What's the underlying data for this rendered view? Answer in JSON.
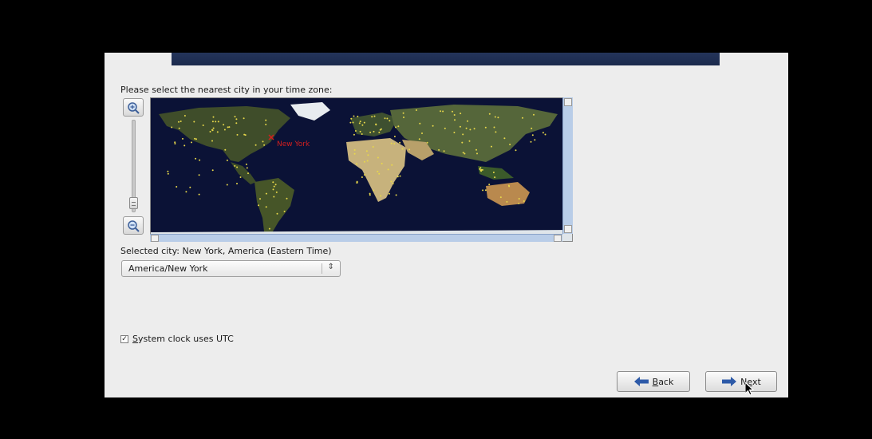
{
  "prompt_label": "Please select the nearest city in your time zone:",
  "map": {
    "highlighted_city": "New York",
    "marker_color": "#d21f1f",
    "city_dot_color": "#e8d84a",
    "ocean_color": "#0b1236"
  },
  "selected_city_label": "Selected city: New York, America (Eastern Time)",
  "timezone_select": {
    "value": "America/New York"
  },
  "utc_checkbox": {
    "checked": true,
    "label_prefix": "",
    "label_mnemonic": "S",
    "label_rest": "ystem clock uses UTC"
  },
  "buttons": {
    "back": {
      "mnemonic": "B",
      "rest": "ack"
    },
    "next": {
      "prefix": "N",
      "mnemonic": "e",
      "rest": "xt"
    }
  },
  "colors": {
    "header_bar": "#1f2e52",
    "window_bg": "#ededed",
    "scrollbar": "#b9cde8"
  }
}
